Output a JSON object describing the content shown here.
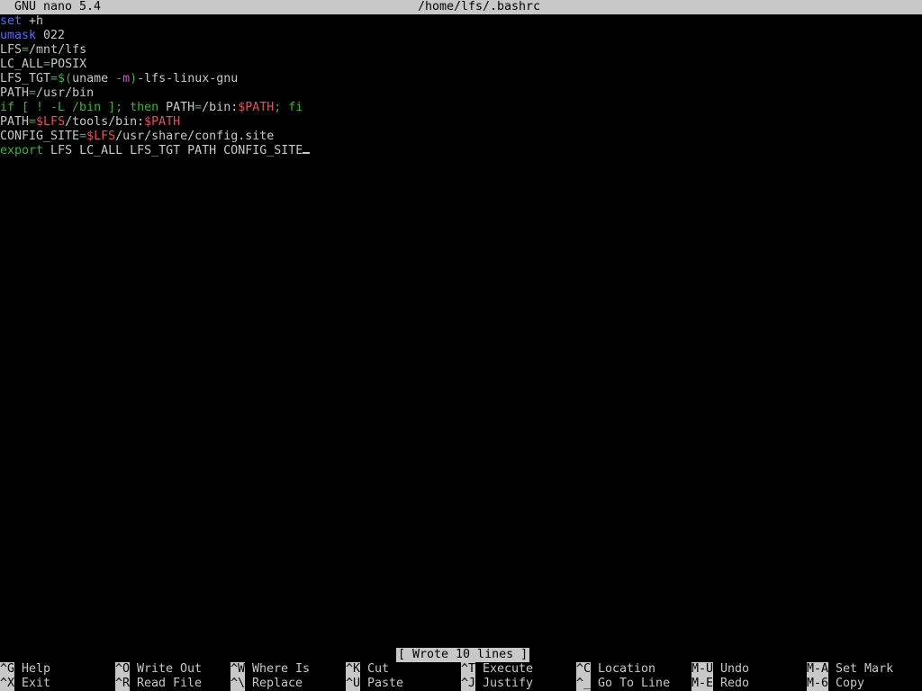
{
  "titlebar": {
    "version": "GNU nano 5.4",
    "path": "/home/lfs/.bashrc"
  },
  "lines": [
    [
      {
        "t": "set",
        "c": "kw-blue"
      },
      {
        "t": " +h",
        "c": ""
      }
    ],
    [
      {
        "t": "umask",
        "c": "kw-blue"
      },
      {
        "t": " 022",
        "c": ""
      }
    ],
    [
      {
        "t": "LFS",
        "c": ""
      },
      {
        "t": "=",
        "c": "sym-green"
      },
      {
        "t": "/mnt/lfs",
        "c": ""
      }
    ],
    [
      {
        "t": "LC_ALL",
        "c": ""
      },
      {
        "t": "=",
        "c": "sym-green"
      },
      {
        "t": "POSIX",
        "c": ""
      }
    ],
    [
      {
        "t": "LFS_TGT",
        "c": ""
      },
      {
        "t": "=$(",
        "c": "sym-green"
      },
      {
        "t": "uname ",
        "c": ""
      },
      {
        "t": "-m",
        "c": "opt-purple"
      },
      {
        "t": ")",
        "c": "sym-green"
      },
      {
        "t": "-lfs-linux-gnu",
        "c": ""
      }
    ],
    [
      {
        "t": "PATH",
        "c": ""
      },
      {
        "t": "=",
        "c": "sym-green"
      },
      {
        "t": "/usr/bin",
        "c": ""
      }
    ],
    [
      {
        "t": "if [ ! -L /bin ]; then",
        "c": "kw-green"
      },
      {
        "t": " PATH",
        "c": ""
      },
      {
        "t": "=",
        "c": "sym-green"
      },
      {
        "t": "/bin:",
        "c": ""
      },
      {
        "t": "$PATH",
        "c": "var-red"
      },
      {
        "t": "; fi",
        "c": "kw-green"
      }
    ],
    [
      {
        "t": "PATH",
        "c": ""
      },
      {
        "t": "=",
        "c": "sym-green"
      },
      {
        "t": "$LFS",
        "c": "var-red"
      },
      {
        "t": "/tools/bin:",
        "c": ""
      },
      {
        "t": "$PATH",
        "c": "var-red"
      }
    ],
    [
      {
        "t": "CONFIG_SITE",
        "c": ""
      },
      {
        "t": "=",
        "c": "sym-green"
      },
      {
        "t": "$LFS",
        "c": "var-red"
      },
      {
        "t": "/usr/share/config.site",
        "c": ""
      }
    ],
    [
      {
        "t": "export",
        "c": "kw-green"
      },
      {
        "t": " LFS LC_ALL LFS_TGT PATH CONFIG_SITE",
        "c": ""
      }
    ]
  ],
  "status": "[ Wrote 10 lines ]",
  "shortcuts": [
    {
      "key": "^G",
      "label": "Help"
    },
    {
      "key": "^X",
      "label": "Exit"
    },
    {
      "key": "^O",
      "label": "Write Out"
    },
    {
      "key": "^R",
      "label": "Read File"
    },
    {
      "key": "^W",
      "label": "Where Is"
    },
    {
      "key": "^\\",
      "label": "Replace"
    },
    {
      "key": "^K",
      "label": "Cut"
    },
    {
      "key": "^U",
      "label": "Paste"
    },
    {
      "key": "^T",
      "label": "Execute"
    },
    {
      "key": "^J",
      "label": "Justify"
    },
    {
      "key": "^C",
      "label": "Location"
    },
    {
      "key": "^_",
      "label": "Go To Line"
    },
    {
      "key": "M-U",
      "label": "Undo"
    },
    {
      "key": "M-E",
      "label": "Redo"
    },
    {
      "key": "M-A",
      "label": "Set Mark"
    },
    {
      "key": "M-6",
      "label": "Copy"
    }
  ]
}
